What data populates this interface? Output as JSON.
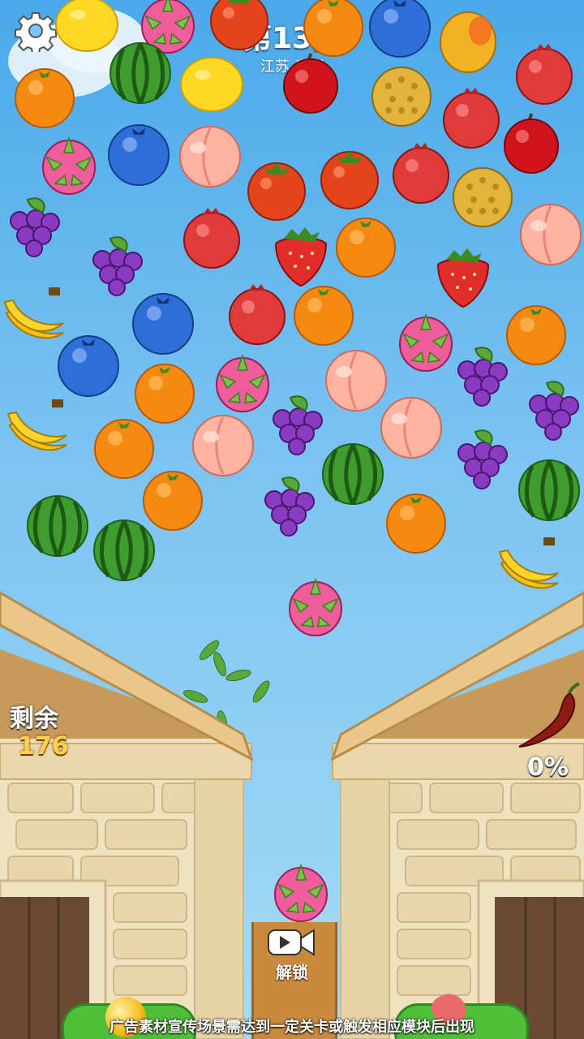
{
  "level": {
    "title": "第13关",
    "location": "江苏-泰兴"
  },
  "remaining": {
    "label": "剩余",
    "value": "176"
  },
  "progress": {
    "label": "0%",
    "fraction": 0
  },
  "unlock": {
    "label": "解锁",
    "icon": "video-camera-icon"
  },
  "settings_icon": "gear-icon",
  "footer_notice": "广告素材宣传场景需达到一定关卡或触发相应模块后出现",
  "colors": {
    "sky_top": "#4aa9ea",
    "sky_bottom": "#a7daf6",
    "counter_value": "#ffd24a",
    "wall": "#eadbb6"
  },
  "fruits": [
    "lemon",
    "dragonfruit",
    "tomato",
    "orange",
    "blueberry",
    "mango",
    "orange",
    "watermelon",
    "lemon",
    "cherry",
    "durian",
    "pomegranate",
    "dragonfruit",
    "blueberry",
    "peach",
    "pomegranate",
    "cherry",
    "grapes",
    "tomato",
    "tomato",
    "pomegranate",
    "durian",
    "pomegranate",
    "strawberry",
    "orange",
    "peach",
    "grapes",
    "strawberry",
    "banana",
    "blueberry",
    "pomegranate",
    "orange",
    "dragonfruit",
    "orange",
    "blueberry",
    "orange",
    "dragonfruit",
    "peach",
    "grapes",
    "banana",
    "grapes",
    "peach",
    "grapes",
    "orange",
    "peach",
    "watermelon",
    "grapes",
    "orange",
    "grapes",
    "orange",
    "watermelon",
    "watermelon",
    "watermelon",
    "banana"
  ],
  "falling_fruit": "dragonfruit",
  "next_fruit": "dragonfruit"
}
